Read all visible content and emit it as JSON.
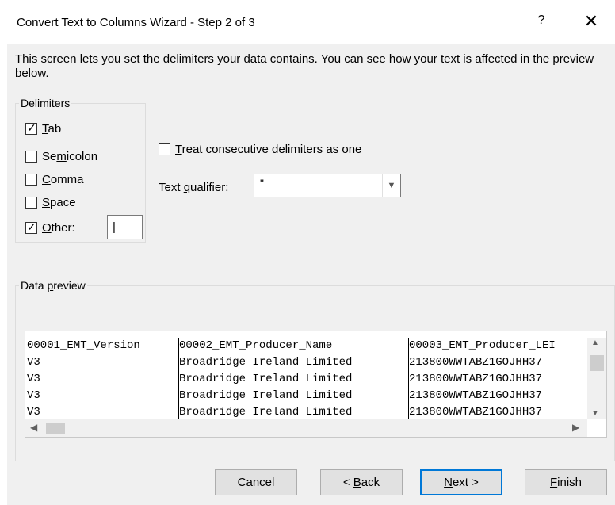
{
  "dialog": {
    "title": "Convert Text to Columns Wizard - Step 2 of 3",
    "help_glyph": "?",
    "close_glyph": "✕"
  },
  "instructions": "This screen lets you set the delimiters your data contains.  You can see how your text is affected in the preview below.",
  "delimiters": {
    "title": "Delimiters",
    "items": [
      {
        "prefix": "",
        "key": "T",
        "suffix": "ab",
        "checked": true
      },
      {
        "prefix": "Se",
        "key": "m",
        "suffix": "icolon",
        "checked": false
      },
      {
        "prefix": "",
        "key": "C",
        "suffix": "omma",
        "checked": false
      },
      {
        "prefix": "",
        "key": "S",
        "suffix": "pace",
        "checked": false
      },
      {
        "prefix": "",
        "key": "O",
        "suffix": "ther:",
        "checked": true
      }
    ],
    "other_value": "|"
  },
  "consecutive": {
    "key": "T",
    "suffix": "reat consecutive delimiters as one",
    "checked": false
  },
  "text_qualifier": {
    "prefix": "Text ",
    "key": "q",
    "suffix": "ualifier:",
    "value": "\""
  },
  "preview": {
    "title_prefix": "Data ",
    "title_key": "p",
    "title_suffix": "review",
    "columns": [
      [
        "00001_EMT_Version",
        "V3",
        "V3",
        "V3",
        "V3"
      ],
      [
        "00002_EMT_Producer_Name",
        "Broadridge Ireland Limited",
        "Broadridge Ireland Limited",
        "Broadridge Ireland Limited",
        "Broadridge Ireland Limited"
      ],
      [
        "00003_EMT_Producer_LEI",
        "213800WWTABZ1GOJHH37",
        "213800WWTABZ1GOJHH37",
        "213800WWTABZ1GOJHH37",
        "213800WWTABZ1GOJHH37"
      ]
    ]
  },
  "buttons": {
    "cancel": "Cancel",
    "back_prefix": "< ",
    "back_key": "B",
    "back_suffix": "ack",
    "next_key": "N",
    "next_suffix": "ext >",
    "finish_key": "F",
    "finish_suffix": "inish"
  },
  "arrows": {
    "up": "▲",
    "down": "▼",
    "left": "◀",
    "right": "▶",
    "dropdown": "▼",
    "check": "✓"
  }
}
